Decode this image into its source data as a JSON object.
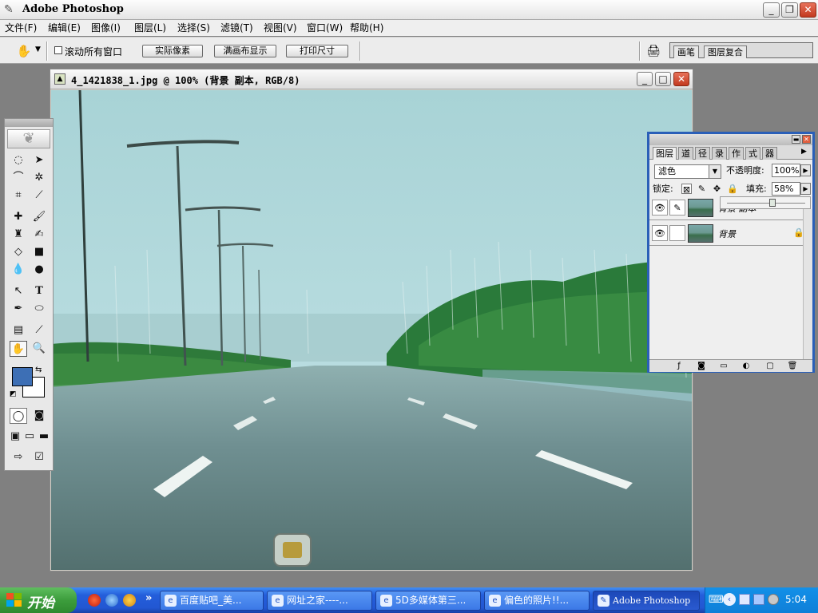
{
  "app": {
    "title": "Adobe Photoshop"
  },
  "window_controls": {
    "minimize": "_",
    "restore": "❐",
    "close": "✕"
  },
  "menubar": [
    "文件(F)",
    "编辑(E)",
    "图像(I)",
    "图层(L)",
    "选择(S)",
    "滤镜(T)",
    "视图(V)",
    "窗口(W)",
    "帮助(H)"
  ],
  "options_bar": {
    "tool_icon": "hand-icon",
    "scroll_all_label": "滚动所有窗口",
    "scroll_all_checked": false,
    "buttons": [
      "实际像素",
      "满画布显示",
      "打印尺寸"
    ],
    "palette_well_tabs": [
      "画笔",
      "图层复合"
    ]
  },
  "document": {
    "title": "4_1421838_1.jpg @ 100% (背景 副本, RGB/8)",
    "zoom": "100%"
  },
  "toolbox": {
    "selected_tool": "hand",
    "foreground_color": "#3d6fb5",
    "background_color": "#ffffff"
  },
  "layers_palette": {
    "tabs": [
      "图层",
      "道",
      "径",
      "录",
      "作",
      "式",
      "器"
    ],
    "blend_mode": "滤色",
    "opacity_label": "不透明度:",
    "opacity": "100%",
    "lock_label": "锁定:",
    "fill_label": "填充:",
    "fill": "58%",
    "fill_fraction": 0.58,
    "layers": [
      {
        "name": "背景 副本",
        "visible": true,
        "selected": true,
        "locked": false
      },
      {
        "name": "背景",
        "visible": true,
        "selected": false,
        "locked": true
      }
    ]
  },
  "taskbar": {
    "start_label": "开始",
    "more": "»",
    "tasks": [
      {
        "label": "百度贴吧_美...",
        "active": false
      },
      {
        "label": "网址之家----...",
        "active": false
      },
      {
        "label": "5D多媒体第三...",
        "active": false
      },
      {
        "label": "偏色的照片!!...",
        "active": false
      },
      {
        "label": "Adobe Photoshop",
        "active": true
      }
    ],
    "clock": "5:04"
  }
}
